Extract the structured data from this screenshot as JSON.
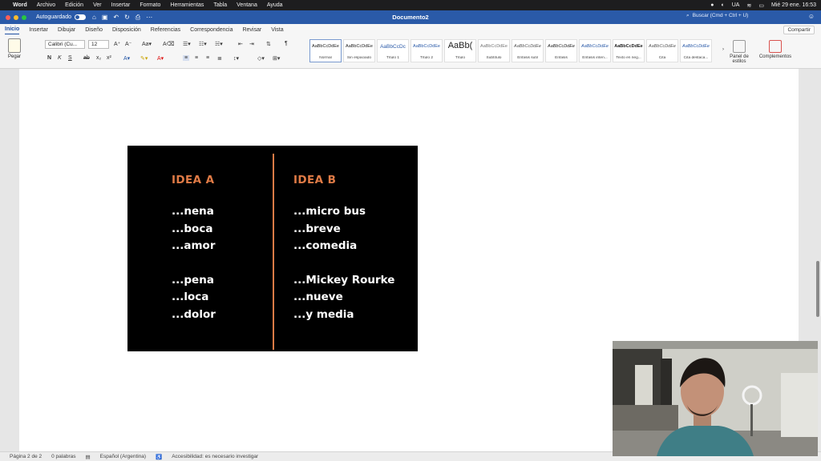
{
  "menubar": {
    "app": "Word",
    "items": [
      "Archivo",
      "Edición",
      "Ver",
      "Insertar",
      "Formato",
      "Herramientas",
      "Tabla",
      "Ventana",
      "Ayuda"
    ],
    "clock": "Mié 29 ene.  16:53",
    "input_source": "UA"
  },
  "titlebar": {
    "autosave_label": "Autoguardado",
    "toggle_text": "NO",
    "document_title": "Documento2",
    "search_placeholder": "Buscar (Cmd + Ctrl + U)"
  },
  "tabs": [
    "Inicio",
    "Insertar",
    "Dibujar",
    "Diseño",
    "Disposición",
    "Referencias",
    "Correspondencia",
    "Revisar",
    "Vista"
  ],
  "share_label": "Compartir",
  "ribbon": {
    "paste_label": "Pegar",
    "font_name": "Calibri (Cu...",
    "font_size": "12",
    "styles": [
      {
        "preview": "AaBbCcDdEe",
        "label": "Normal"
      },
      {
        "preview": "AaBbCcDdEe",
        "label": "Sin espaciado"
      },
      {
        "preview": "AaBbCcDc",
        "label": "Título 1"
      },
      {
        "preview": "AaBbCcDdEe",
        "label": "Título 2"
      },
      {
        "preview": "AaBb(",
        "label": "Título"
      },
      {
        "preview": "AaBbCcDdEe",
        "label": "Subtítulo"
      },
      {
        "preview": "AaBbCcDdEe",
        "label": "Énfasis sutil"
      },
      {
        "preview": "AaBbCcDdEe",
        "label": "Énfasis"
      },
      {
        "preview": "AaBbCcDdEe",
        "label": "Énfasis inten..."
      },
      {
        "preview": "AaBbCcDdEe",
        "label": "Texto en neg..."
      },
      {
        "preview": "AaBbCcDdEe",
        "label": "Cita"
      },
      {
        "preview": "AaBbCcDdEe",
        "label": "Cita destaca..."
      }
    ],
    "styles_pane_label": "Panel de estilos",
    "addins_label": "Complementos"
  },
  "slide": {
    "idea_a": {
      "heading": "IDEA A",
      "group1": [
        "...nena",
        "...boca",
        "...amor"
      ],
      "group2": [
        "...pena",
        "...loca",
        "...dolor"
      ]
    },
    "idea_b": {
      "heading": "IDEA B",
      "group1": [
        "...micro bus",
        "...breve",
        "...comedia"
      ],
      "group2": [
        "...Mickey Rourke",
        "...nueve",
        "...y media"
      ]
    }
  },
  "status": {
    "page": "Página 2 de 2",
    "words": "0 palabras",
    "language": "Español (Argentina)",
    "accessibility": "Accesibilidad: es necesario investigar"
  },
  "colors": {
    "accent_orange": "#e07b46",
    "title_bar_blue": "#2a5aa8",
    "slide_bg": "#000000"
  }
}
